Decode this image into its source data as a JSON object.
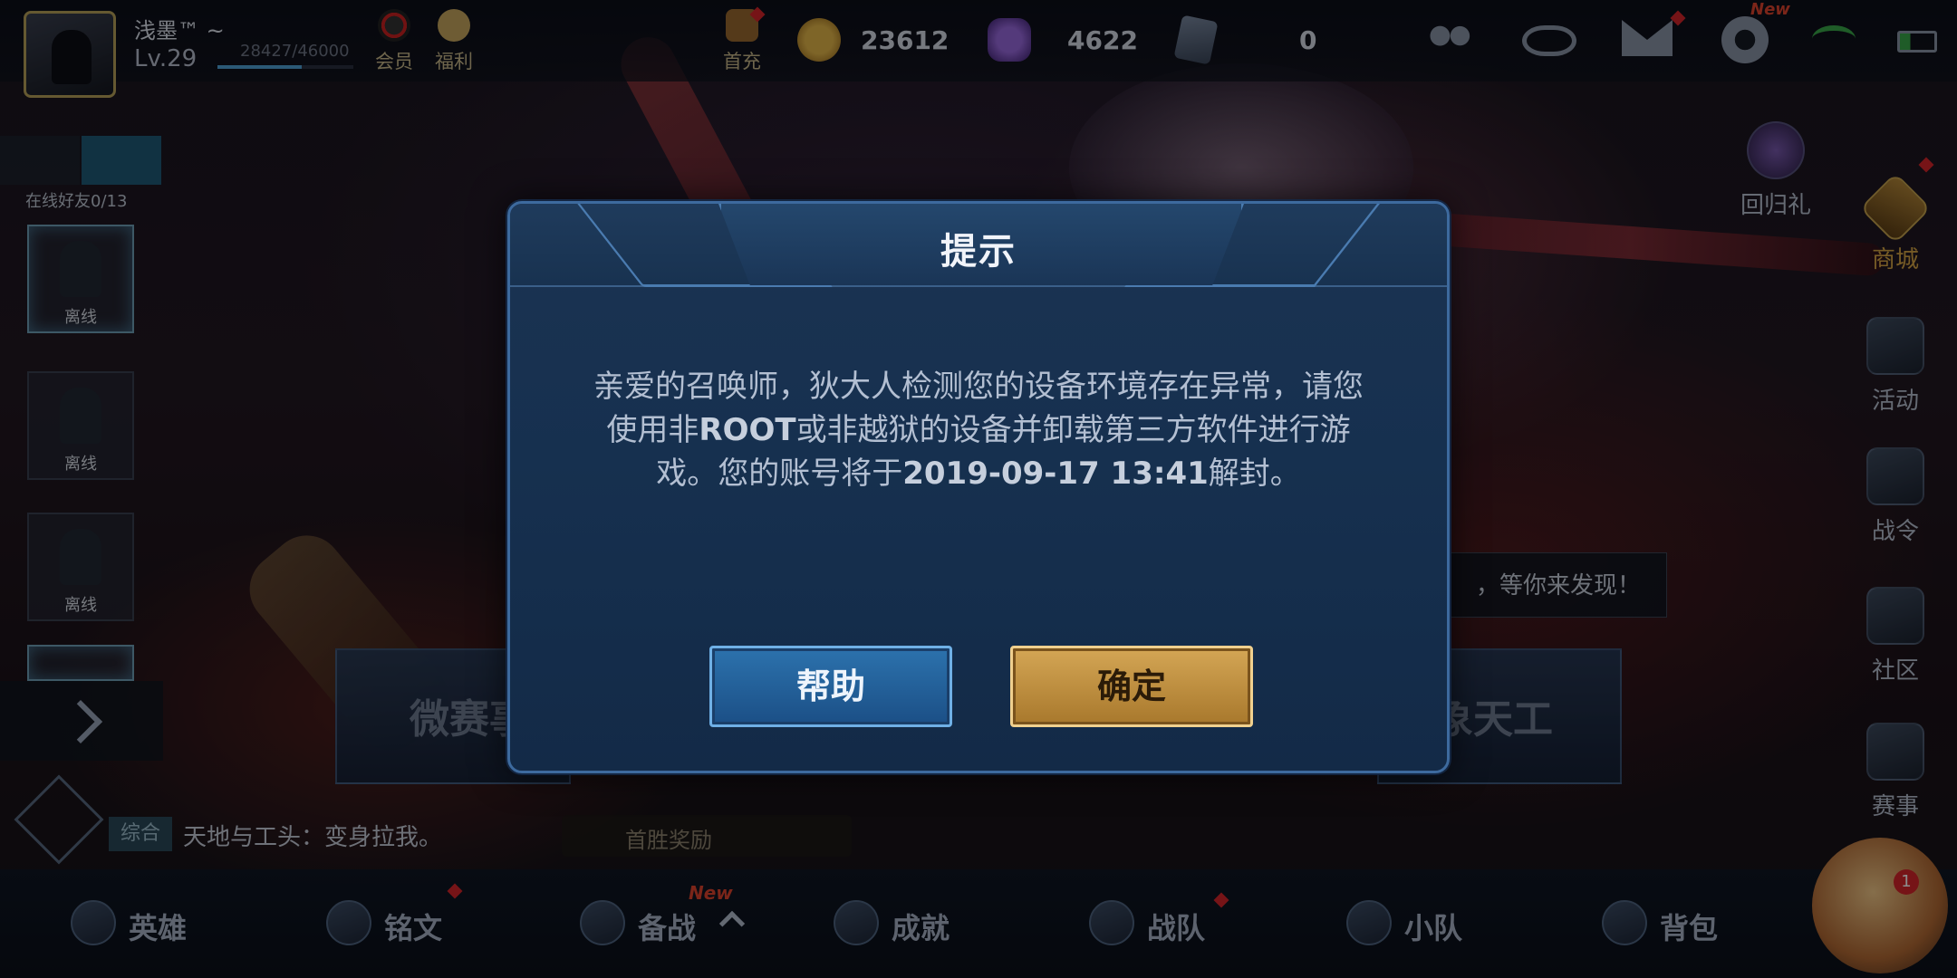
{
  "player": {
    "name": "浅墨™ ~",
    "level": "Lv.29",
    "exp_text": "28427/46000",
    "exp_progress": 0.618
  },
  "top_bar": {
    "vip_label": "会员",
    "welfare_label": "福利",
    "first_recharge_label": "首充",
    "gold": "23612",
    "diamonds": "4622",
    "vouchers": "0",
    "new_badge": "New"
  },
  "friends_panel": {
    "online_count": "在线好友0/13",
    "slots": [
      {
        "status": "离线"
      },
      {
        "status": "离线"
      },
      {
        "status": "离线"
      }
    ]
  },
  "side_menu": {
    "return_gift": "回归礼",
    "shop": "商城",
    "activity": "活动",
    "battle_pass": "战令",
    "community": "社区",
    "events": "赛事"
  },
  "discover_text": "，等你来发现！",
  "banners": {
    "left": "微赛事",
    "right": "象天工"
  },
  "first_win_label": "首胜奖励",
  "chat": {
    "tag": "综合",
    "message": "天地与工头：变身拉我。"
  },
  "bottom_nav": {
    "items": [
      "英雄",
      "铭文",
      "备战",
      "成就",
      "战队",
      "小队",
      "背包"
    ],
    "new_badge": "New",
    "mascot_badge": "1"
  },
  "modal": {
    "title": "提示",
    "message_part1": "亲爱的召唤师，狄大人检测您的设备环境存在异常，请您使用非",
    "message_root": "ROOT",
    "message_part2": "或非越狱的设备并卸载第三方软件进行游戏。您的账号将于",
    "message_date": "2019-09-17 13:41",
    "message_part3": "解封。",
    "help_button": "帮助",
    "confirm_button": "确定"
  },
  "colors": {
    "modal_bg": "#16304f",
    "modal_border": "#3d6a9e",
    "help_button": "#2c72ad",
    "confirm_button": "#d4a655",
    "new_badge": "#e0442f"
  }
}
